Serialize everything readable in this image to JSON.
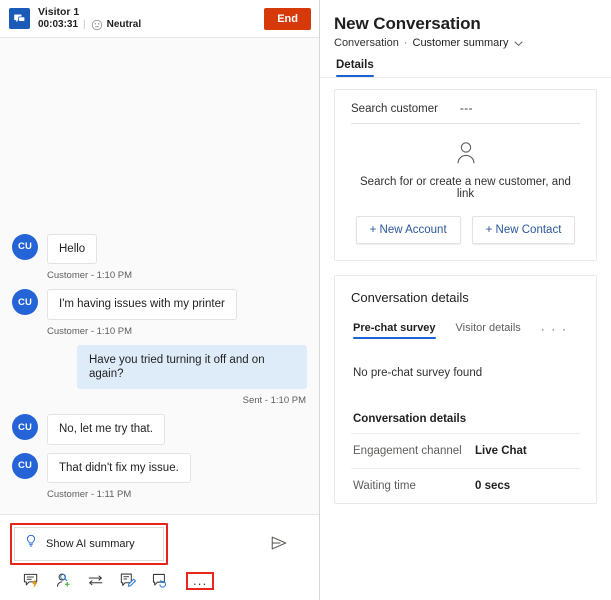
{
  "chat": {
    "header": {
      "visitor_icon": "chat-bubble-icon",
      "visitor_name": "Visitor 1",
      "elapsed_time": "00:03:31",
      "sentiment_icon": "neutral-face-icon",
      "sentiment_label": "Neutral",
      "end_label": "End"
    },
    "messages": [
      {
        "side": "in",
        "avatar": "CU",
        "text": "Hello",
        "status": "Customer - 1:10 PM"
      },
      {
        "side": "in",
        "avatar": "CU",
        "text": "I'm having issues with my printer",
        "status": "Customer - 1:10 PM"
      },
      {
        "side": "out",
        "avatar": "",
        "text": "Have you tried turning it off and on again?",
        "status": "Sent - 1:10 PM"
      },
      {
        "side": "in",
        "avatar": "CU",
        "text": "No, let me try that.",
        "status": ""
      },
      {
        "side": "in",
        "avatar": "CU",
        "text": "That didn't fix my issue.",
        "status": "Customer - 1:11 PM"
      }
    ],
    "compose": {
      "ai_summary_icon": "lightbulb-icon",
      "ai_summary_label": "Show AI summary",
      "send_icon": "send-icon",
      "highlight_color": "#e8251b"
    },
    "toolbar": {
      "items": [
        {
          "icon": "quick-replies-icon",
          "label": "Quick replies"
        },
        {
          "icon": "add-participant-icon",
          "label": "Add participant"
        },
        {
          "icon": "transfer-icon",
          "label": "Transfer"
        },
        {
          "icon": "notes-icon",
          "label": "Notes"
        },
        {
          "icon": "conversation-summary-icon",
          "label": "Conversation summary"
        }
      ],
      "more_label": "..."
    }
  },
  "details": {
    "title": "New Conversation",
    "breadcrumb": {
      "root": "Conversation",
      "separator": "·",
      "current": "Customer summary",
      "chevron_icon": "chevron-down-icon"
    },
    "tabs": [
      {
        "label": "Details",
        "active": true
      }
    ],
    "customer_card": {
      "search_label": "Search customer",
      "search_value": "---",
      "person_icon": "person-icon",
      "empty_text": "Search for or create a new customer, and link",
      "buttons": [
        {
          "label": "+ New Account"
        },
        {
          "label": "+ New Contact"
        }
      ]
    },
    "conversation_card": {
      "title": "Conversation details",
      "subtabs": [
        {
          "label": "Pre-chat survey",
          "active": true
        },
        {
          "label": "Visitor details",
          "active": false
        }
      ],
      "subtab_overflow": "· · ·",
      "empty_survey": "No pre-chat survey found",
      "section_heading": "Conversation details",
      "fields": [
        {
          "key": "Engagement channel",
          "value": "Live Chat"
        },
        {
          "key": "Waiting time",
          "value": "0 secs"
        }
      ]
    }
  },
  "colors": {
    "accent": "#1a62d1",
    "danger": "#d63a0a",
    "highlight": "#e8251b",
    "avatar": "#2464d6",
    "out_bubble": "#deecf9"
  }
}
